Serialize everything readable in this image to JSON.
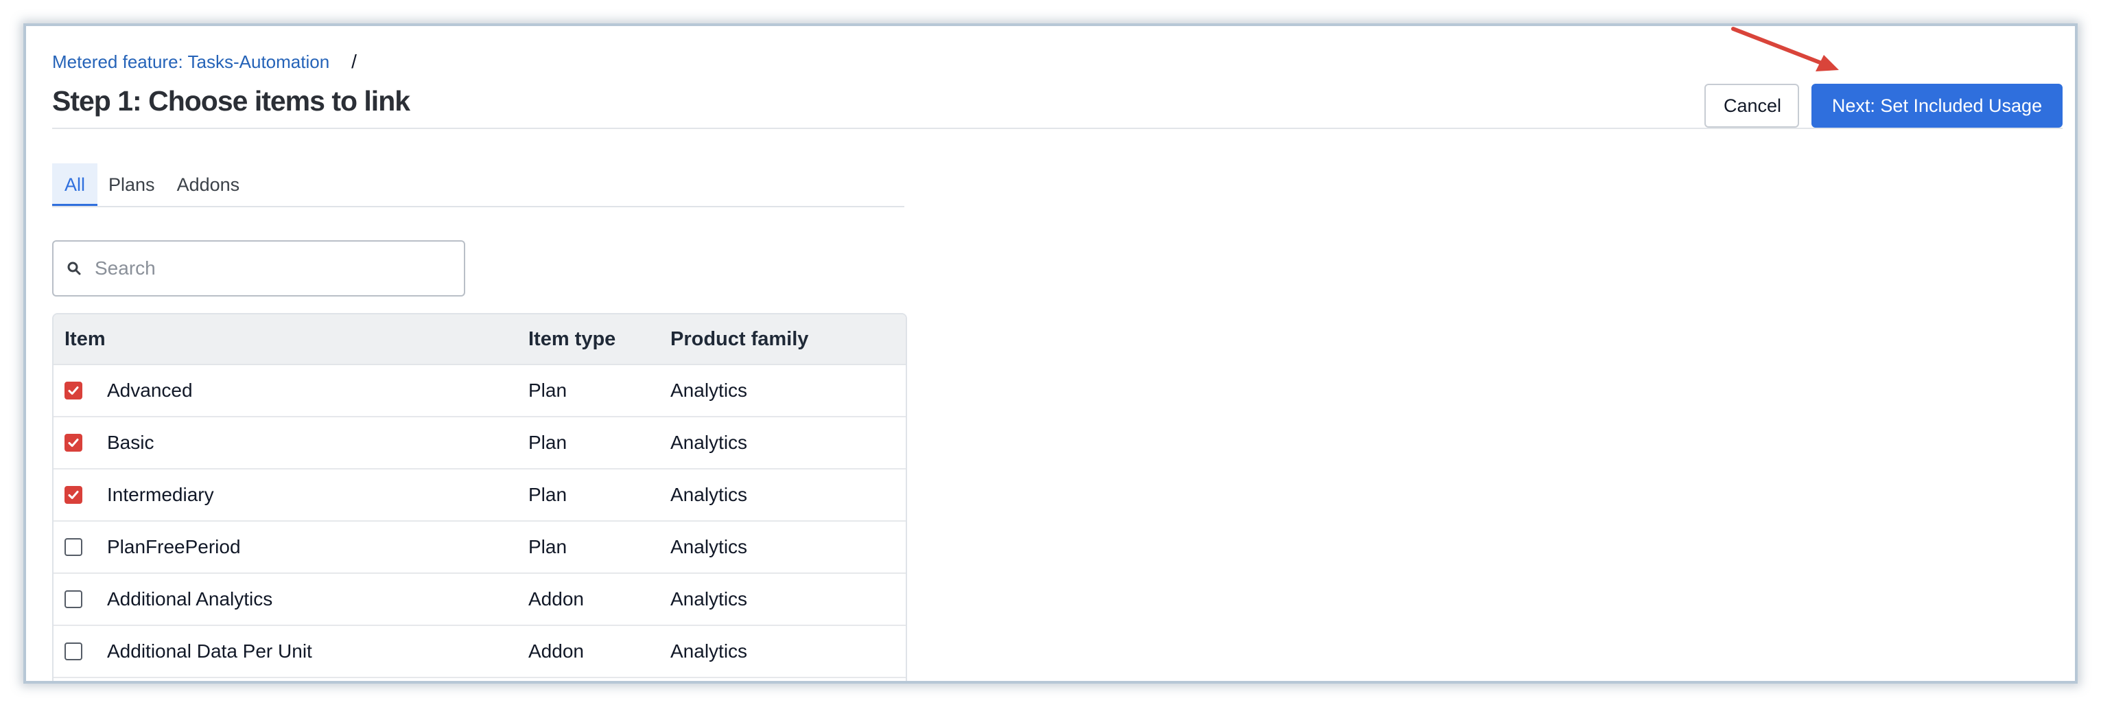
{
  "breadcrumb": {
    "link": "Metered feature: Tasks-Automation",
    "separator": "/"
  },
  "page": {
    "title": "Step 1: Choose items to link"
  },
  "actions": {
    "cancel": "Cancel",
    "next": "Next: Set Included Usage"
  },
  "tabs": [
    {
      "label": "All",
      "active": true
    },
    {
      "label": "Plans",
      "active": false
    },
    {
      "label": "Addons",
      "active": false
    }
  ],
  "search": {
    "placeholder": "Search",
    "value": ""
  },
  "table": {
    "headers": {
      "item": "Item",
      "type": "Item type",
      "family": "Product family"
    },
    "rows": [
      {
        "checked": true,
        "item": "Advanced",
        "type": "Plan",
        "family": "Analytics"
      },
      {
        "checked": true,
        "item": "Basic",
        "type": "Plan",
        "family": "Analytics"
      },
      {
        "checked": true,
        "item": "Intermediary",
        "type": "Plan",
        "family": "Analytics"
      },
      {
        "checked": false,
        "item": "PlanFreePeriod",
        "type": "Plan",
        "family": "Analytics"
      },
      {
        "checked": false,
        "item": "Additional Analytics",
        "type": "Addon",
        "family": "Analytics"
      },
      {
        "checked": false,
        "item": "Additional Data Per Unit",
        "type": "Addon",
        "family": "Analytics"
      }
    ]
  },
  "colors": {
    "primary": "#2f6fdd",
    "checkbox_checked": "#d9403a",
    "link": "#2563b8",
    "annotation_arrow": "#d9443a"
  },
  "icons": {
    "search": "search-icon",
    "check": "check-icon",
    "annotation": "arrow-icon"
  }
}
